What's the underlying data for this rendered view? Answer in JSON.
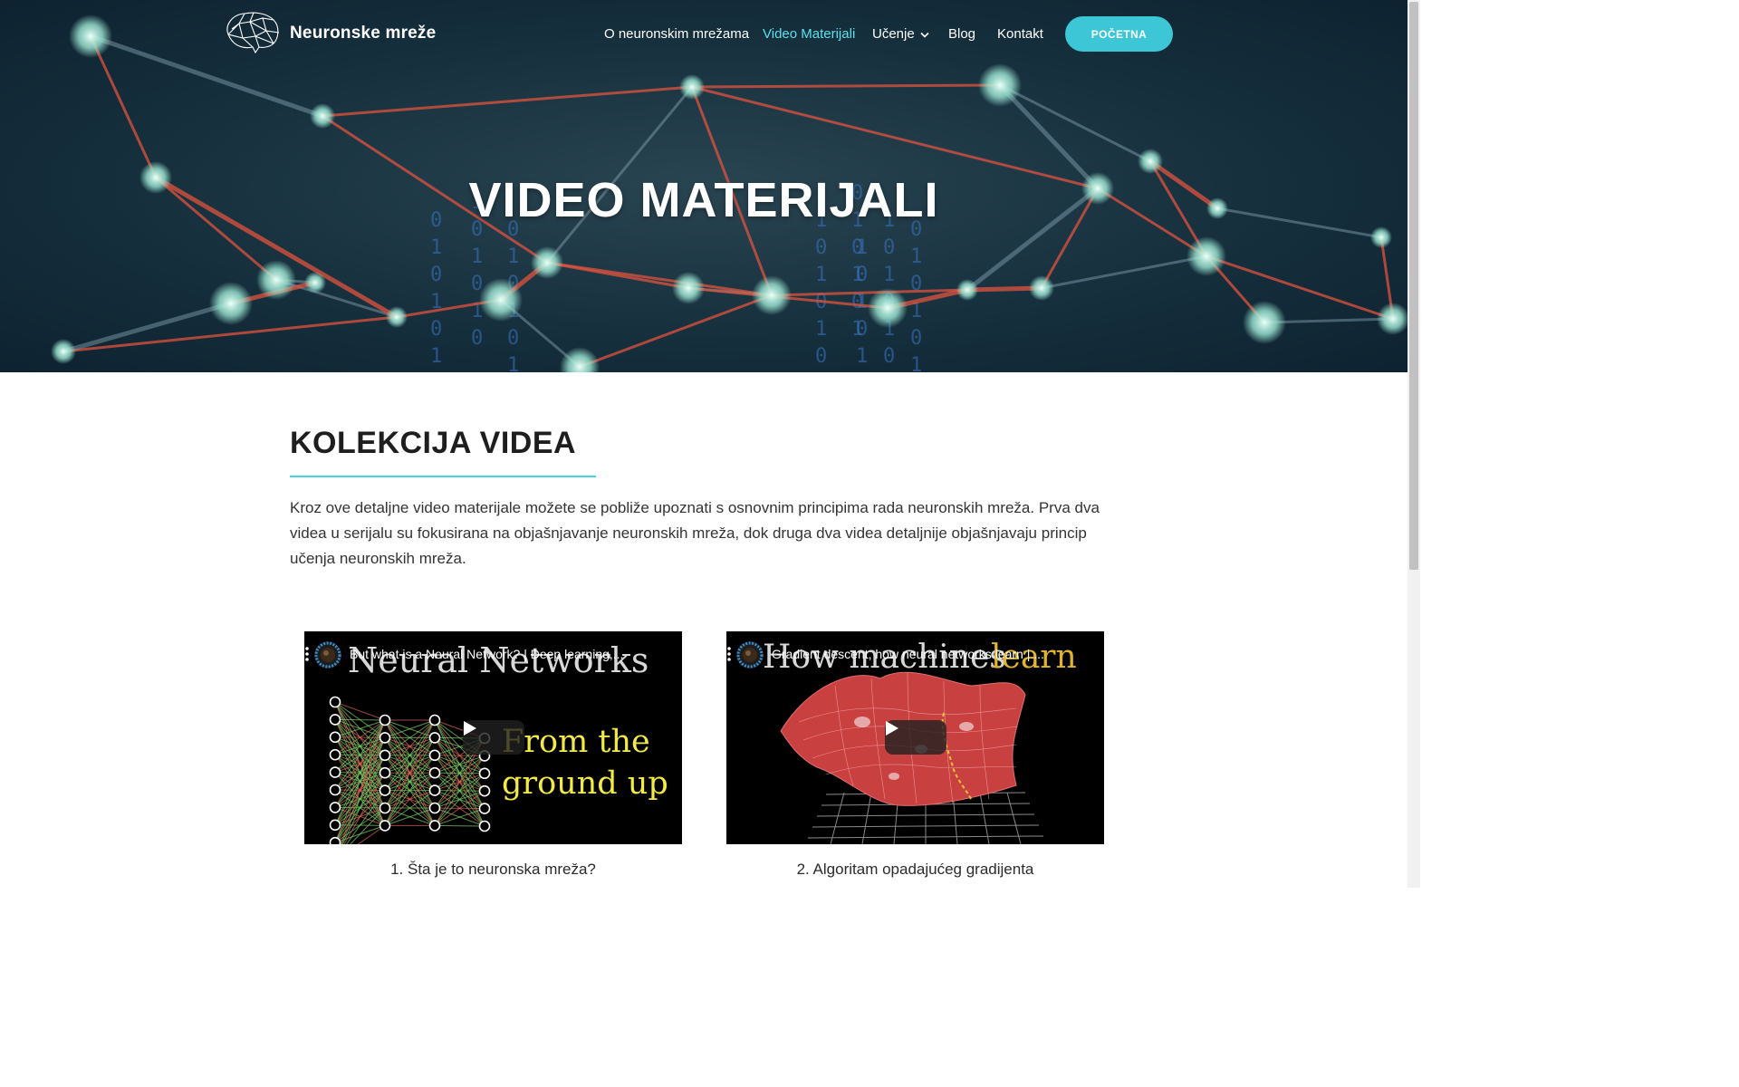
{
  "brand": {
    "name": "Neuronske mreže"
  },
  "nav": {
    "items": [
      {
        "label": "O neuronskim mrežama",
        "active": false
      },
      {
        "label": "Video Materijali",
        "active": true
      },
      {
        "label": "Učenje",
        "active": false,
        "dropdown": true
      },
      {
        "label": "Blog",
        "active": false
      },
      {
        "label": "Kontakt",
        "active": false
      }
    ],
    "cta": "POČETNA"
  },
  "hero": {
    "title": "VIDEO MATERIJALI"
  },
  "section": {
    "title": "KOLEKCIJA VIDEA",
    "intro": "Kroz ove detaljne video materijale možete se pobliže upoznati s osnovnim principima rada neuronskih mreža. Prva dva videa u serijalu su fokusirana na objašnjavanje neuronskih mreža, dok druga dva videa detaljnije objašnjavaju princip učenja neuronskih mreža."
  },
  "videos": [
    {
      "title": "But what is a Neural Network? | Deep learning,...",
      "thumb_heading": "Neural Networks",
      "thumb_sub1": "From the",
      "thumb_sub2": "ground up",
      "caption": "1. Šta je to neuronska mreža?"
    },
    {
      "title": "Gradient descent, how neural networks learn | ...",
      "thumb_heading_a": "How machines",
      "thumb_heading_b": "learn",
      "caption": "2. Algoritam opadajućeg gradijenta"
    }
  ],
  "colors": {
    "accent": "#3cc6d6",
    "nav_active": "#5fe0ec",
    "underline": "#48d5e3"
  }
}
